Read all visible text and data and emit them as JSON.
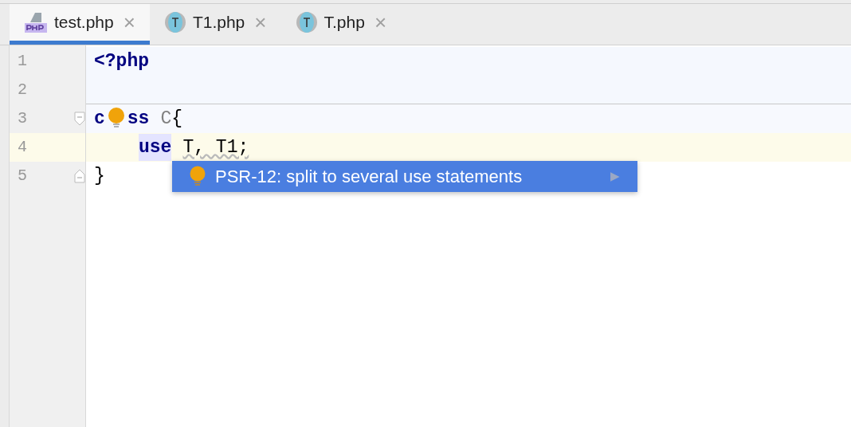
{
  "tabs": [
    {
      "label": "test.php",
      "kind": "php",
      "selected": true,
      "close": "×"
    },
    {
      "label": "T1.php",
      "kind": "trait",
      "selected": false,
      "close": "×"
    },
    {
      "label": "T.php",
      "kind": "trait",
      "selected": false,
      "close": "×"
    }
  ],
  "editor": {
    "lines": [
      {
        "number": "1",
        "kind": "header",
        "current": false,
        "tokens": [
          {
            "kind": "tag",
            "text": "<?php"
          }
        ]
      },
      {
        "number": "2",
        "kind": "header",
        "current": false
      },
      {
        "number": "3",
        "kind": "foldstart",
        "current": false,
        "bulb": true,
        "tokens": [
          {
            "kind": "keyword",
            "text": "c"
          },
          {
            "kind": "keyword",
            "text": "ss"
          },
          {
            "kind": "name",
            "text": "C",
            "space": true
          },
          {
            "kind": "plain",
            "text": "{"
          }
        ]
      },
      {
        "number": "4",
        "kind": "code",
        "current": true,
        "indent": true,
        "tokens": [
          {
            "kind": "keyword",
            "text": "use",
            "highlight": true
          },
          {
            "kind": "plain",
            "text": "T, T1;",
            "squiggle": true,
            "space": true
          }
        ]
      },
      {
        "number": "5",
        "kind": "foldend",
        "current": false,
        "tokens": [
          {
            "kind": "plain",
            "text": "}"
          }
        ]
      }
    ]
  },
  "intention_popup": {
    "label": "PSR-12: split to several use statements",
    "submenu": "▶"
  }
}
